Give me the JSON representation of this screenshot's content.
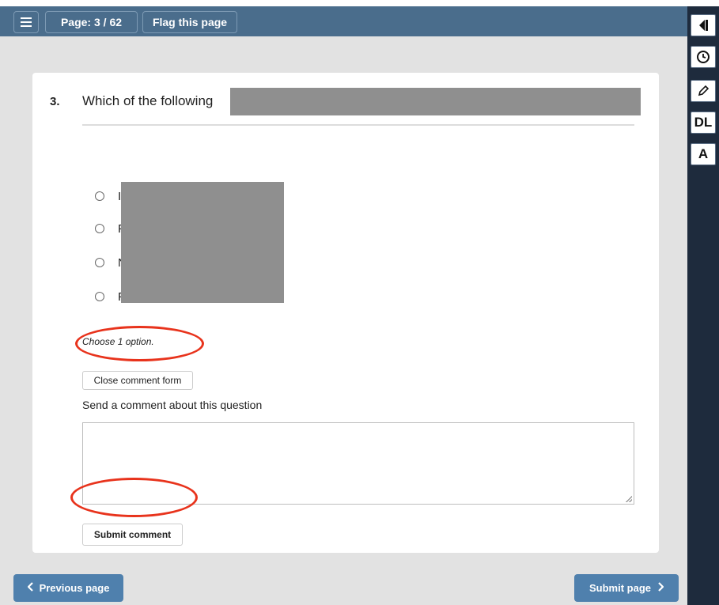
{
  "toolbar": {
    "menu_icon": "hamburger-menu-icon",
    "page_label": "Page: 3 / 62",
    "flag_label": "Flag this page"
  },
  "question": {
    "number": "3.",
    "text": "Which of the following",
    "options": [
      {
        "letter": "I"
      },
      {
        "letter": "F"
      },
      {
        "letter": "N"
      },
      {
        "letter": "F"
      }
    ],
    "instruction": "Choose 1 option."
  },
  "comment": {
    "close_label": "Close comment form",
    "prompt": "Send a comment about this question",
    "textarea_value": "",
    "submit_label": "Submit comment"
  },
  "nav": {
    "prev_label": "Previous page",
    "submit_label": "Submit page"
  },
  "sidebar": {
    "collapse_icon": "collapse-panel-icon",
    "clock_icon": "clock-icon",
    "pencil_icon": "pencil-icon",
    "dl_label": "DL",
    "a_label": "A"
  },
  "colors": {
    "topbar": "#4a6d8c",
    "sidebar": "#1e2b3d",
    "nav_button": "#4f80ad",
    "highlight": "#e8331c"
  }
}
